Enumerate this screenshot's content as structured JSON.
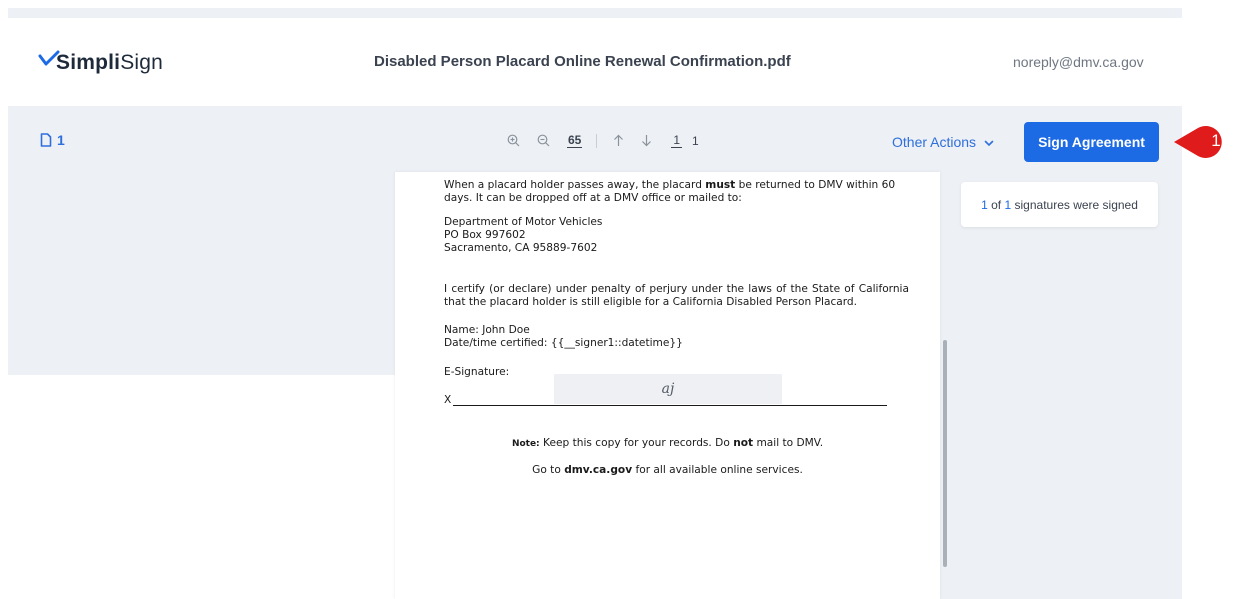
{
  "header": {
    "logo_bold": "Simpli",
    "logo_rest": "Sign",
    "document_title": "Disabled Person Placard Online Renewal Confirmation.pdf",
    "sender_email": "noreply@dmv.ca.gov"
  },
  "sidebar": {
    "page_count": "1"
  },
  "toolbar": {
    "zoom_level": "65",
    "current_page": "1",
    "total_pages": "1",
    "other_actions_label": "Other Actions",
    "sign_button_label": "Sign Agreement"
  },
  "annotation": {
    "marker": "1"
  },
  "signature_status": {
    "signed": "1",
    "of_word": "of",
    "total": "1",
    "suffix": "signatures were signed"
  },
  "document": {
    "para1_a": "When a placard holder passes away, the placard ",
    "para1_bold": "must",
    "para1_b": " be returned to DMV within 60 days. It can be dropped off at a DMV office or mailed to:",
    "address_line1": "Department of Motor Vehicles",
    "address_line2": "PO Box 997602",
    "address_line3": "Sacramento, CA 95889-7602",
    "certify_text": "I certify (or declare) under penalty of perjury under the laws of the State of California that the placard holder is still eligible for a California Disabled Person Placard.",
    "name_line": "Name:  John Doe",
    "datetime_line": "Date/time certified: {{__signer1::datetime}}",
    "esig_label": "E-Signature:",
    "x_mark": "X",
    "signature_initials": "aj",
    "note_label": "Note:",
    "note_a": " Keep this copy for your records. Do ",
    "note_bold": "not",
    "note_b": " mail to DMV.",
    "goto_a": "Go to ",
    "goto_bold": "dmv.ca.gov",
    "goto_b": " for all available online services."
  },
  "colors": {
    "accent": "#1d6ae5",
    "annotation_red": "#e01b1b",
    "background": "#edf0f5"
  }
}
